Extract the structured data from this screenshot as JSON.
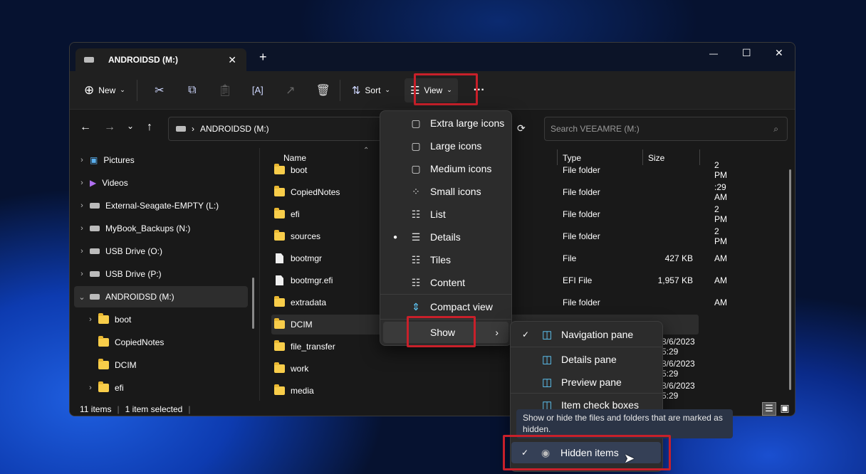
{
  "window": {
    "tab_title": "ANDROIDSD (M:)",
    "new_tab": "+",
    "controls": {
      "minimize": "—",
      "maximize": "☐",
      "close": "✕"
    }
  },
  "toolbar": {
    "new": "New",
    "sort": "Sort",
    "view": "View",
    "more": "···"
  },
  "address": {
    "path": "ANDROIDSD (M:)",
    "search_placeholder": "Search VEEAMRE (M:)"
  },
  "sidebar": [
    {
      "label": "Pictures",
      "type": "pictures",
      "expand": "›"
    },
    {
      "label": "Videos",
      "type": "videos",
      "expand": "›"
    },
    {
      "label": "External-Seagate-EMPTY (L:)",
      "type": "drive",
      "expand": "›"
    },
    {
      "label": "MyBook_Backups (N:)",
      "type": "drive",
      "expand": "›"
    },
    {
      "label": "USB Drive (O:)",
      "type": "drive",
      "expand": "›"
    },
    {
      "label": "USB Drive (P:)",
      "type": "drive",
      "expand": "›"
    },
    {
      "label": "ANDROIDSD (M:)",
      "type": "drive",
      "expand": "⌄",
      "selected": true
    },
    {
      "label": "boot",
      "type": "folder",
      "expand": "›",
      "child": true
    },
    {
      "label": "CopiedNotes",
      "type": "folder",
      "expand": "",
      "child": true
    },
    {
      "label": "DCIM",
      "type": "folder",
      "expand": "",
      "child": true
    },
    {
      "label": "efi",
      "type": "folder",
      "expand": "›",
      "child": true
    }
  ],
  "columns": {
    "name": "Name",
    "type": "Type",
    "size": "Size"
  },
  "files": [
    {
      "name": "boot",
      "kind": "folder",
      "date": "2 PM",
      "type": "File folder",
      "size": ""
    },
    {
      "name": "CopiedNotes",
      "kind": "folder",
      "date": ":29 AM",
      "type": "File folder",
      "size": ""
    },
    {
      "name": "efi",
      "kind": "folder",
      "date": "2 PM",
      "type": "File folder",
      "size": ""
    },
    {
      "name": "sources",
      "kind": "folder",
      "date": "2 PM",
      "type": "File folder",
      "size": ""
    },
    {
      "name": "bootmgr",
      "kind": "file",
      "date": "AM",
      "type": "File",
      "size": "427 KB"
    },
    {
      "name": "bootmgr.efi",
      "kind": "file",
      "date": "AM",
      "type": "EFI File",
      "size": "1,957 KB"
    },
    {
      "name": "extradata",
      "kind": "folder",
      "date": "AM",
      "type": "File folder",
      "size": ""
    },
    {
      "name": "DCIM",
      "kind": "folder",
      "date": "",
      "type": "",
      "size": "",
      "selected": true
    },
    {
      "name": "file_transfer",
      "kind": "folder",
      "date": "8/6/2023 5:29",
      "type": "",
      "size": ""
    },
    {
      "name": "work",
      "kind": "folder",
      "date": "8/6/2023 5:29",
      "type": "",
      "size": ""
    },
    {
      "name": "media",
      "kind": "folder",
      "date": "8/6/2023 5:29",
      "type": "",
      "size": ""
    }
  ],
  "status": {
    "count": "11 items",
    "selected": "1 item selected"
  },
  "view_menu": [
    {
      "label": "Extra large icons",
      "icon": "extra-large-icons-icon",
      "glyph": "▢"
    },
    {
      "label": "Large icons",
      "icon": "large-icons-icon",
      "glyph": "▢"
    },
    {
      "label": "Medium icons",
      "icon": "medium-icons-icon",
      "glyph": "▢"
    },
    {
      "label": "Small icons",
      "icon": "small-icons-icon",
      "glyph": "⁘"
    },
    {
      "label": "List",
      "icon": "list-icon",
      "glyph": "☷"
    },
    {
      "label": "Details",
      "icon": "details-icon",
      "glyph": "☰",
      "selected": true
    },
    {
      "label": "Tiles",
      "icon": "tiles-icon",
      "glyph": "☷"
    },
    {
      "label": "Content",
      "icon": "content-icon",
      "glyph": "☷"
    }
  ],
  "compact_view": "Compact view",
  "show": "Show",
  "show_menu": [
    {
      "label": "Navigation pane",
      "checked": true
    },
    {
      "label": "Details pane",
      "checked": false
    },
    {
      "label": "Preview pane",
      "checked": false
    },
    {
      "label": "Item check boxes",
      "checked": false
    }
  ],
  "tooltip": "Show or hide the files and folders that are marked as hidden.",
  "hidden_items": "Hidden items",
  "check": "✓",
  "colors": {
    "highlight": "#c8202a",
    "accent": "#60cdff"
  }
}
